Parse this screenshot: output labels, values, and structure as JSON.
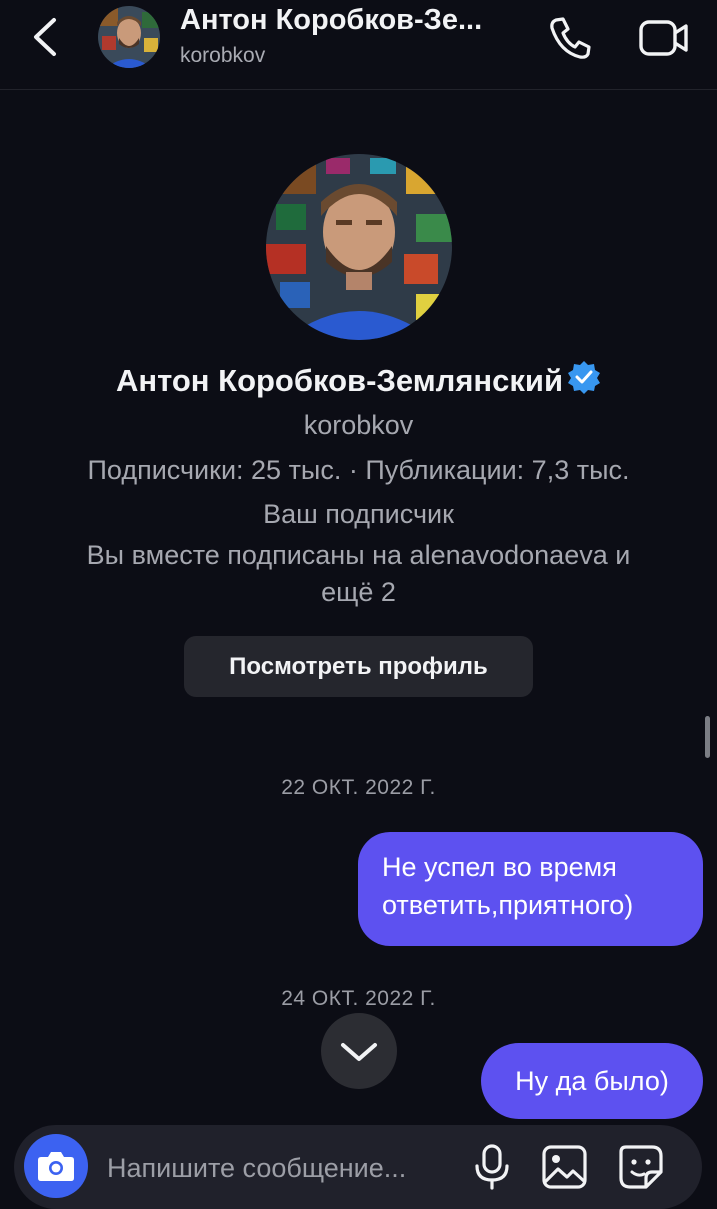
{
  "header": {
    "name": "Антон Коробков-Зе...",
    "username": "korobkov"
  },
  "profile": {
    "full_name": "Антон Коробков-Землянский",
    "username": "korobkov",
    "stats": "Подписчики: 25 тыс. · Публикации: 7,3 тыс.",
    "follows_you": "Ваш подписчик",
    "mutual_line1": "Вы вместе подписаны на alenavodonaeva и",
    "mutual_line2": "ещё 2",
    "view_profile_label": "Посмотреть профиль"
  },
  "messages": [
    {
      "date": "22 ОКТ. 2022 Г.",
      "text_line1": "Не успел во время",
      "text_line2": "ответить,приятного)"
    },
    {
      "date": "24 ОКТ. 2022 Г.",
      "text": "Ну да было)"
    }
  ],
  "composer": {
    "placeholder": "Напишите сообщение..."
  },
  "colors": {
    "background": "#0c0d15",
    "bubble": "#5d51f0",
    "camera_button": "#3c62f1",
    "verified": "#3897f0"
  }
}
